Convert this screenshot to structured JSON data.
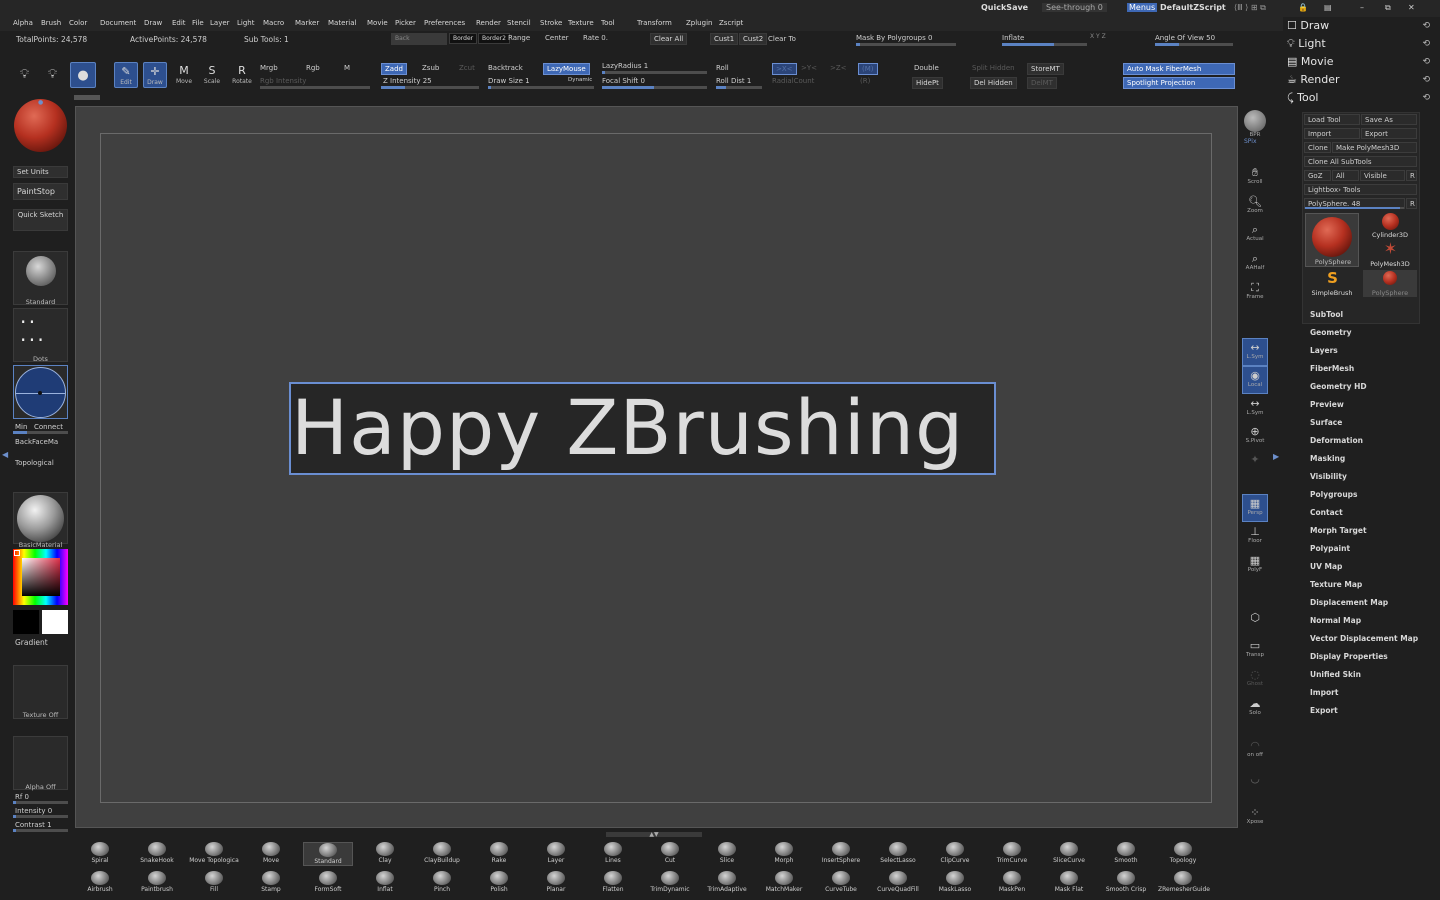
{
  "menus": [
    "Alpha",
    "Brush",
    "Color",
    "Document",
    "Draw",
    "Edit",
    "File",
    "Layer",
    "Light",
    "Macro",
    "Marker",
    "Material",
    "Movie",
    "Picker",
    "Preferences",
    "Render",
    "Stencil",
    "Stroke",
    "Texture",
    "Tool",
    "Transform",
    "Zplugin",
    "Zscript"
  ],
  "topright": {
    "quicksave": "QuickSave",
    "seethrough": "See-through   0",
    "menus": "Menus",
    "script": "DefaultZScript"
  },
  "stats": {
    "total_points": "TotalPoints: 24,578",
    "active_points": "ActivePoints: 24,578",
    "sub_tools": "Sub Tools: 1"
  },
  "toolbar_row1": {
    "back": "Back",
    "border": "Border",
    "border2": "Border2",
    "range": "Range",
    "center": "Center",
    "rate": "Rate 0.",
    "clear_all": "Clear All",
    "cust1": "Cust1",
    "cust2": "Cust2",
    "clear_to": "Clear To",
    "mask_by_polygroups": "Mask By Polygroups 0",
    "inflate": "Inflate",
    "xyz": "X Y Z",
    "angle_of_view": "Angle Of View 50"
  },
  "tools": {
    "edit": "Edit",
    "draw": "Draw",
    "move": "Move",
    "scale": "Scale",
    "rotate": "Rotate"
  },
  "draw_opts": {
    "mrgb": "Mrgb",
    "rgb": "Rgb",
    "m": "M",
    "rgb_intensity": "Rgb Intensity",
    "zadd": "Zadd",
    "zsub": "Zsub",
    "zcut": "Zcut",
    "z_intensity": "Z Intensity 25",
    "backtrack": "Backtrack",
    "lazymouse": "LazyMouse",
    "lazyradius": "LazyRadius 1",
    "draw_size": "Draw Size 1",
    "dynamic": "Dynamic",
    "focal_shift": "Focal Shift 0",
    "roll": "Roll",
    "roll_dist": "Roll Dist 1",
    "radialcount": "RadialCount",
    "x": ">X<",
    "y": ">Y<",
    "z": ">Z<",
    "m2": "(M)",
    "r": "(R)",
    "double": "Double",
    "split_hidden": "Split Hidden",
    "storemt": "StoreMT",
    "hidept": "HidePt",
    "del_hidden": "Del Hidden",
    "delmt": "DelMT",
    "auto_mask_fibermesh": "Auto Mask FiberMesh",
    "spotlight_projection": "Spotlight Projection"
  },
  "left": {
    "set_units": "Set Units",
    "paintstop": "PaintStop",
    "quick_sketch": "Quick Sketch",
    "standard": "Standard",
    "dots": "Dots",
    "min": "Min",
    "connect": "Connect",
    "backfacemask": "BackFaceMa",
    "topological": "Topological",
    "basicmaterial": "BasicMaterial",
    "gradient": "Gradient",
    "texture_off": "Texture Off",
    "alpha_off": "Alpha Off",
    "rf": "Rf 0",
    "intensity": "Intensity 0",
    "contrast": "Contrast 1"
  },
  "canvas": {
    "banner_text": "Happy ZBrushing !!"
  },
  "right_bar": {
    "bpr": "BPR",
    "spix": "SPix",
    "scroll": "Scroll",
    "zoom": "Zoom",
    "actual": "Actual",
    "aahalf": "AAHalf",
    "frame": "Frame",
    "lsym": "L.Sym",
    "local": "Local",
    "lsym2": "L.Sym",
    "spivot": "S.Pivot",
    "persp": "Persp",
    "floor": "Floor",
    "polyf": "PolyF",
    "transp": "Transp",
    "ghost": "Ghost",
    "solo": "Solo",
    "on": "on",
    "off": "off",
    "xpose": "Xpose"
  },
  "panel": {
    "headers": [
      "Draw",
      "Light",
      "Movie",
      "Render",
      "Tool"
    ],
    "load_tool": "Load Tool",
    "save_as": "Save As",
    "import": "Import",
    "export": "Export",
    "clone": "Clone",
    "make_polymesh": "Make PolyMesh3D",
    "clone_all": "Clone All SubTools",
    "goz": "GoZ",
    "all": "All",
    "visible": "Visible",
    "r": "R",
    "lightbox_tools": "Lightbox› Tools",
    "polysphere_slider": "PolySphere. 48",
    "thumbs": [
      "PolySphere",
      "Cylinder3D",
      "PolyMesh3D",
      "SimpleBrush",
      "PolySphere"
    ],
    "items": [
      "SubTool",
      "Geometry",
      "Layers",
      "FiberMesh",
      "Geometry HD",
      "Preview",
      "Surface",
      "Deformation",
      "Masking",
      "Visibility",
      "Polygroups",
      "Contact",
      "Morph Target",
      "Polypaint",
      "UV Map",
      "Texture Map",
      "Displacement Map",
      "Normal Map",
      "Vector Displacement Map",
      "Display Properties",
      "Unified Skin",
      "Import",
      "Export"
    ]
  },
  "brushes_top": [
    "Spiral",
    "SnakeHook",
    "Move Topologica",
    "Move",
    "Standard",
    "Clay",
    "ClayBuildup",
    "Rake",
    "Layer",
    "Lines",
    "Cut",
    "Slice",
    "Morph",
    "InsertSphere",
    "SelectLasso",
    "ClipCurve",
    "TrimCurve",
    "SliceCurve",
    "Smooth",
    "Topology"
  ],
  "brushes_bottom": [
    "Airbrush",
    "Paintbrush",
    "Fill",
    "Stamp",
    "FormSoft",
    "Inflat",
    "Pinch",
    "Polish",
    "Planar",
    "Flatten",
    "TrimDynamic",
    "TrimAdaptive",
    "MatchMaker",
    "CurveTube",
    "CurveQuadFill",
    "MaskLasso",
    "MaskPen",
    "Mask Flat",
    "Smooth Crisp",
    "ZRemesherGuide"
  ],
  "colors": {
    "accent": "#5b82c2",
    "bg": "#1f1f1f",
    "canvas": "#404040",
    "material": "#b53020"
  }
}
